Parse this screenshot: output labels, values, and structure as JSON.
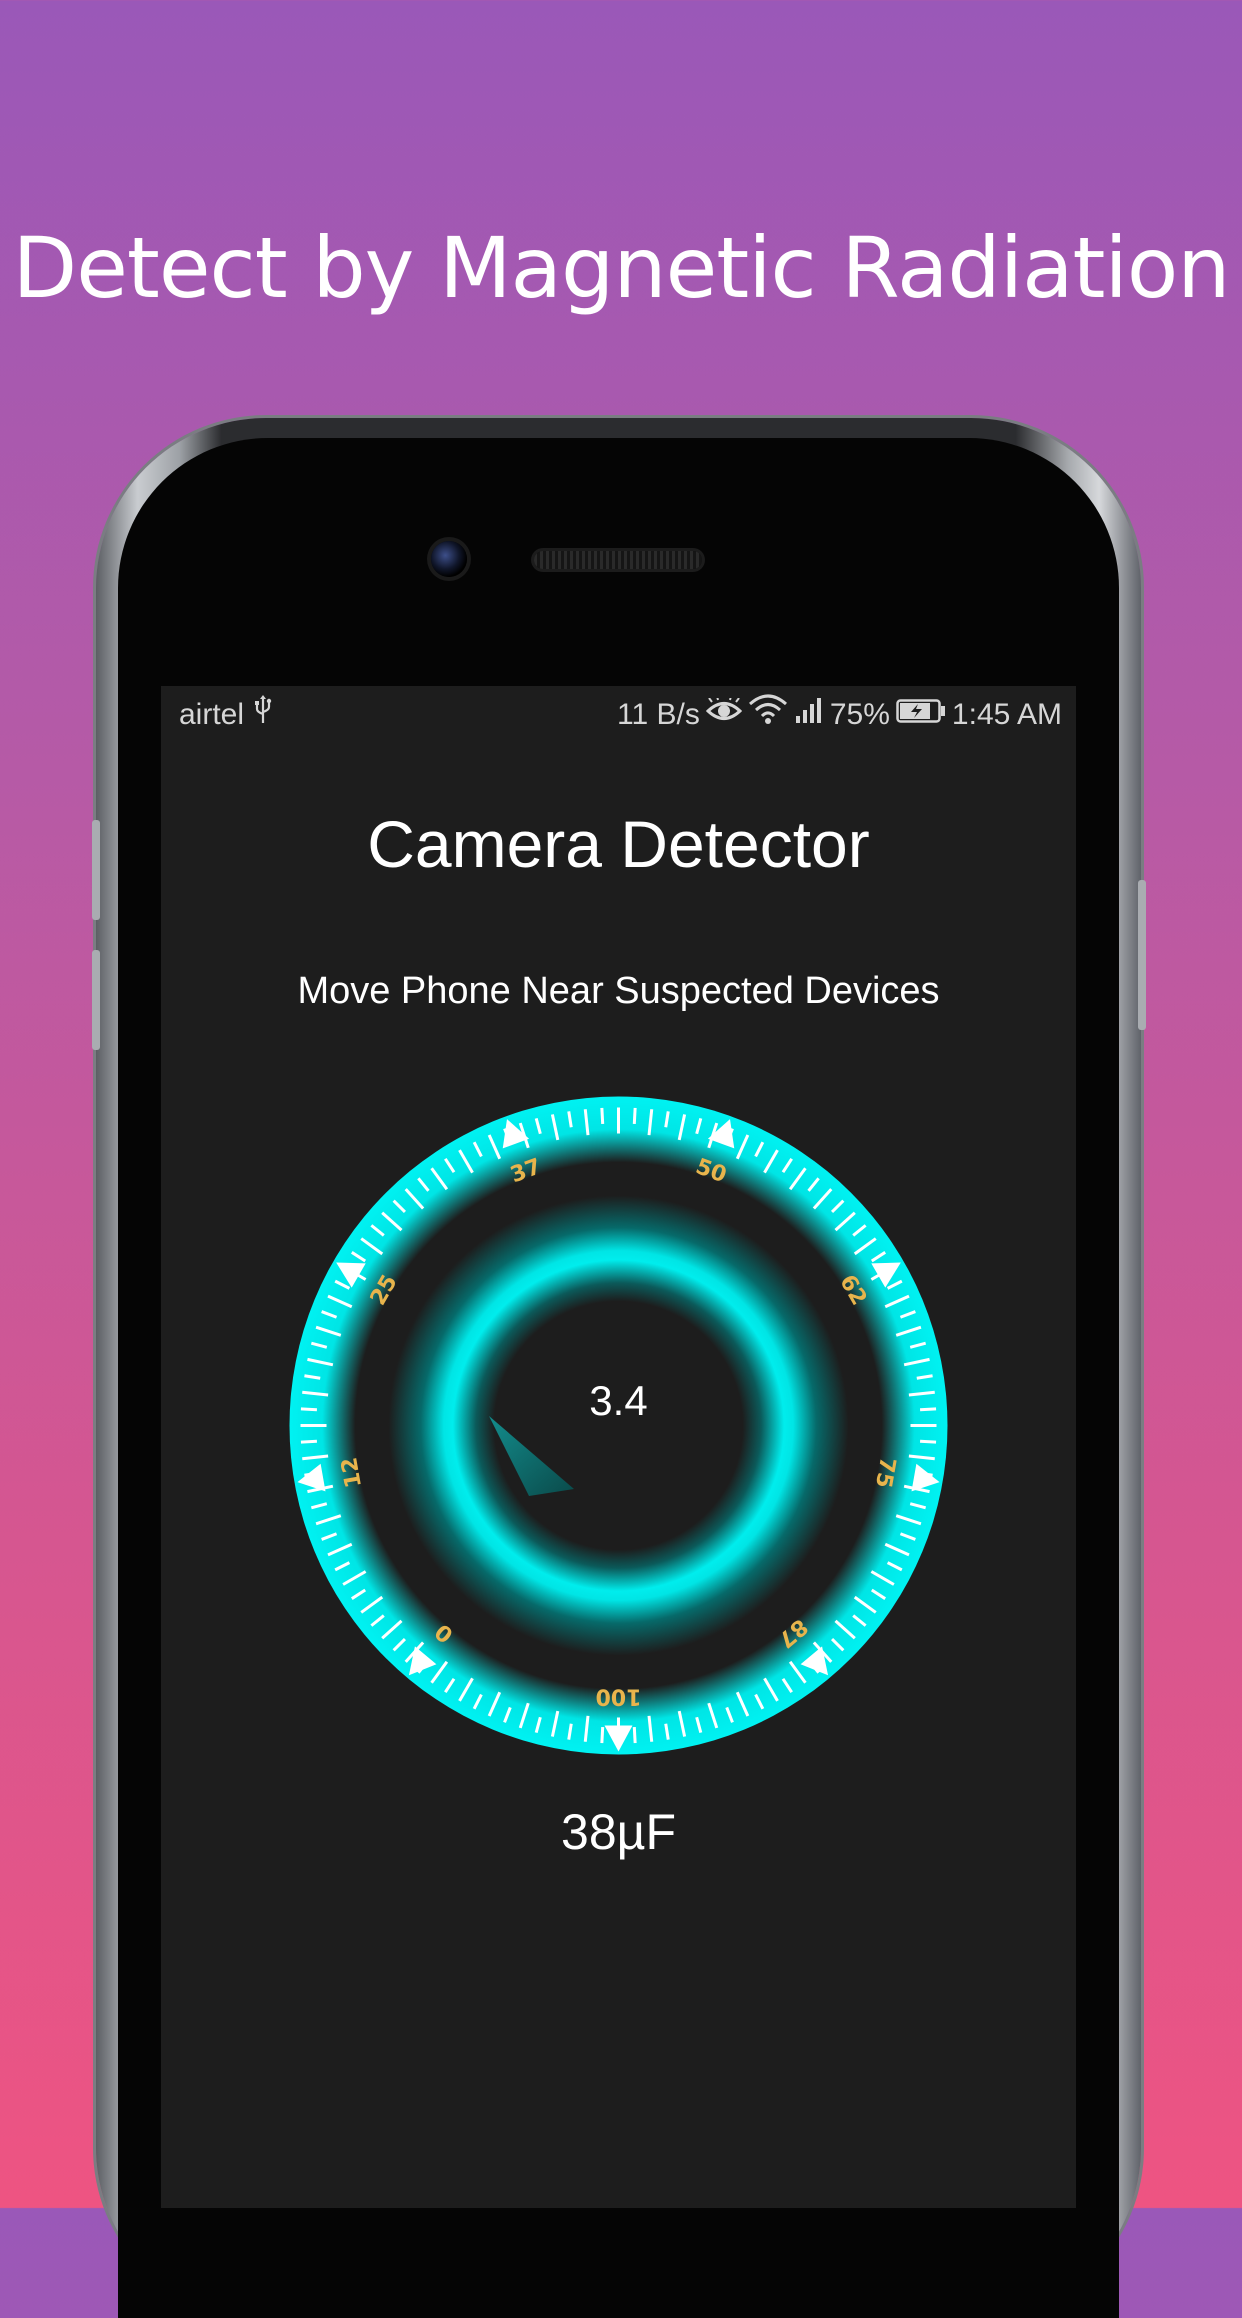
{
  "promo": {
    "headline": "Detect by Magnetic Radiation"
  },
  "status_bar": {
    "carrier": "airtel",
    "usb_icon": "usb-icon",
    "speed": "11 B/s",
    "eye_icon": "eye-icon",
    "wifi_icon": "wifi-icon",
    "signal_icon": "signal-icon",
    "battery": "75%",
    "battery_icon": "battery-charging-icon",
    "time": "1:45 AM"
  },
  "app": {
    "title": "Camera Detector",
    "instruction": "Move Phone Near Suspected Devices",
    "reading": "3.4",
    "unit_reading": "38µF"
  },
  "gauge": {
    "scale_labels": [
      "0",
      "12",
      "25",
      "37",
      "50",
      "62",
      "75",
      "87",
      "100"
    ],
    "accent_color": "#00e5e5",
    "label_color": "#e8b44c"
  }
}
